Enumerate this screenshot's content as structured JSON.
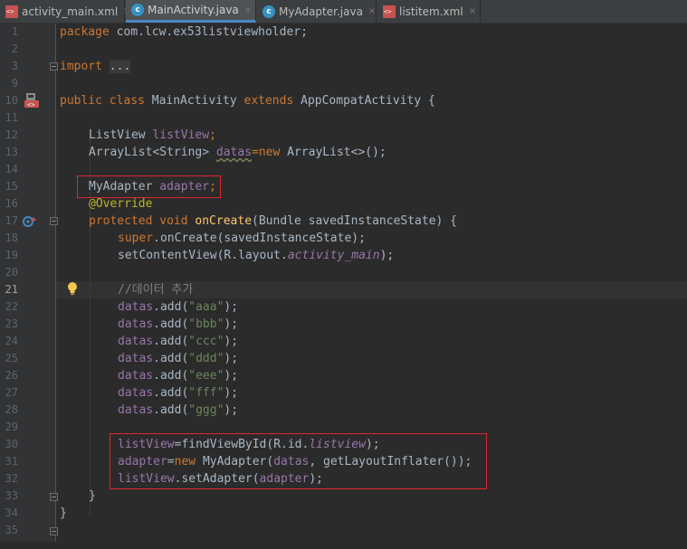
{
  "tabs": [
    {
      "label": "activity_main.xml",
      "icon": "xml-file-icon",
      "active": false
    },
    {
      "label": "MainActivity.java",
      "icon": "java-class-icon",
      "active": true
    },
    {
      "label": "MyAdapter.java",
      "icon": "java-class-icon",
      "active": false
    },
    {
      "label": "listitem.xml",
      "icon": "xml-file-icon",
      "active": false
    }
  ],
  "close_glyph": "×",
  "java_icon_letter": "c",
  "lines": {
    "l1": "1",
    "l2": "2",
    "l3": "3",
    "l9": "9",
    "l10": "10",
    "l11": "11",
    "l12": "12",
    "l13": "13",
    "l14": "14",
    "l15": "15",
    "l16": "16",
    "l17": "17",
    "l18": "18",
    "l19": "19",
    "l20": "20",
    "l21": "21",
    "l22": "22",
    "l23": "23",
    "l24": "24",
    "l25": "25",
    "l26": "26",
    "l27": "27",
    "l28": "28",
    "l29": "29",
    "l30": "30",
    "l31": "31",
    "l32": "32",
    "l33": "33",
    "l34": "34",
    "l35": "35"
  },
  "code": {
    "package_kw": "package",
    "package_name": " com.lcw.ex53listviewholder;",
    "import_kw": "import",
    "import_fold": "...",
    "class_mods": "public class ",
    "class_name": "MainActivity ",
    "extends_kw": "extends ",
    "class_super": "AppCompatActivity {",
    "lv_type": "ListView ",
    "lv_field": "listView",
    "semi": ";",
    "al_type": "ArrayList<String> ",
    "datas_field": "datas",
    "eq_new": "=new ",
    "al_init": "ArrayList<>();",
    "ad_type": "MyAdapter ",
    "ad_field": "adapter",
    "override": "@Override",
    "protected_void": "protected void ",
    "oncreate_name": "onCreate",
    "oncreate_sig": "(Bundle savedInstanceState) {",
    "super_kw": "super",
    "super_call": ".onCreate(savedInstanceState);",
    "setcv_call": "setContentView(R.layout.",
    "layout_name": "activity_main",
    "close_paren": ");",
    "comment": "//데이터 추가",
    "add_call": ".add(",
    "str_aaa": "\"aaa\"",
    "str_bbb": "\"bbb\"",
    "str_ccc": "\"ccc\"",
    "str_ddd": "\"ddd\"",
    "str_eee": "\"eee\"",
    "str_fff": "\"fff\"",
    "str_ggg": "\"ggg\"",
    "fvb_call": "=findViewById(R.id.",
    "id_name": "listview",
    "eq": "=",
    "new_kw": "new ",
    "adapter_ctor": "MyAdapter(",
    "adapter_args": ", getLayoutInflater());",
    "setadapter_call": ".setAdapter(",
    "brace": "}"
  },
  "colors": {
    "keyword": "#cc7832",
    "field": "#9876aa",
    "string": "#6a8759",
    "method": "#ffc66d",
    "annotation": "#bbb529",
    "comment": "#808080",
    "highlight_box": "#e0262d",
    "active_tab_underline": "#4a88c7"
  }
}
